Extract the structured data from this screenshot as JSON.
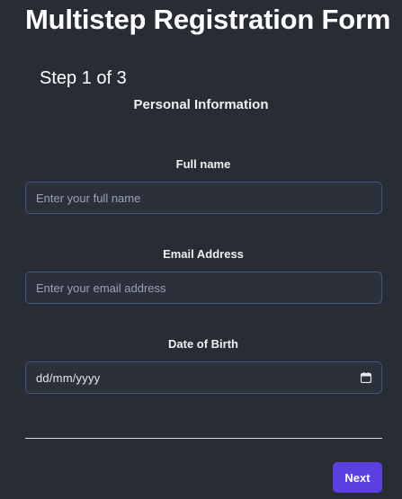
{
  "page_title": "Multistep Registration Form",
  "step_indicator": "Step 1 of 3",
  "section_title": "Personal Information",
  "fields": [
    {
      "label": "Full name",
      "placeholder": "Enter your full name",
      "value": ""
    },
    {
      "label": "Email Address",
      "placeholder": "Enter your email address",
      "value": ""
    },
    {
      "label": "Date of Birth",
      "value": "dd/mm/yyyy",
      "icon": "calendar-icon"
    }
  ],
  "next_label": "Next",
  "colors": {
    "background": "#282c34",
    "field_border": "#3f5680",
    "button": "#5b3fe0"
  }
}
